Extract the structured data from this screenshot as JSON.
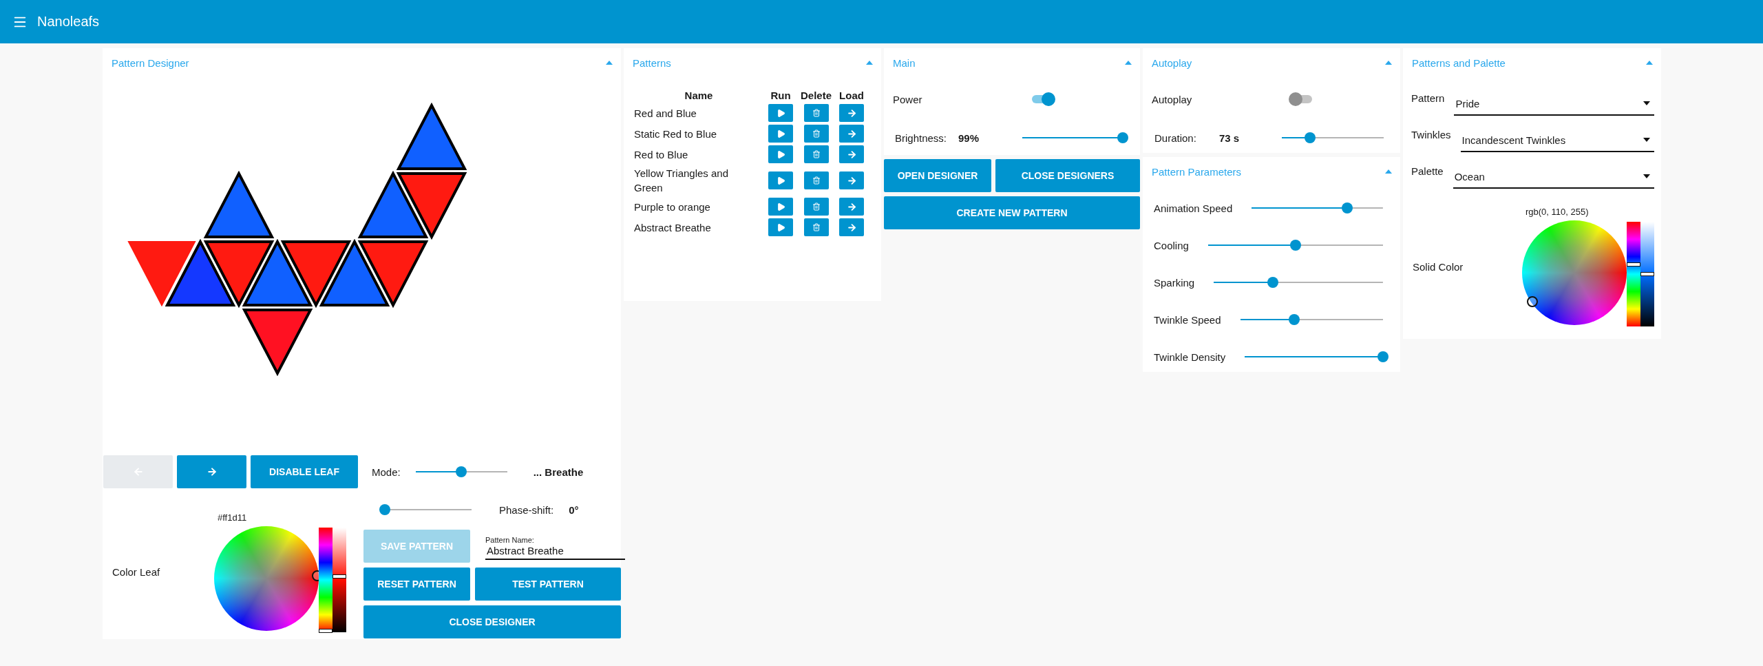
{
  "app_bar": {
    "title": "Nanoleafs"
  },
  "pattern_designer": {
    "title": "Pattern Designer",
    "leaves": [
      {
        "color": "#ff1a11",
        "selected": true
      },
      {
        "color": "#1438ff",
        "selected": false
      },
      {
        "color": "#ff1a11",
        "selected": false
      },
      {
        "color": "#1060ff",
        "selected": false
      },
      {
        "color": "#1060ff",
        "selected": false
      },
      {
        "color": "#ff1122",
        "selected": false
      },
      {
        "color": "#ff1a11",
        "selected": false
      },
      {
        "color": "#1060ff",
        "selected": false
      },
      {
        "color": "#ff1a11",
        "selected": false
      },
      {
        "color": "#1060ff",
        "selected": false
      },
      {
        "color": "#ff1a11",
        "selected": false
      },
      {
        "color": "#1060ff",
        "selected": false
      }
    ],
    "prev_button": {
      "disabled": true
    },
    "next_button": {
      "disabled": false
    },
    "disable_leaf_button": "DISABLE LEAF",
    "mode": {
      "label": "Mode:",
      "level": 0.5,
      "value": "... Breathe"
    },
    "phase": {
      "level": 0.05,
      "label": "Phase-shift:",
      "value": "0°"
    },
    "color_leaf": {
      "label": "Color Leaf",
      "value": "#ff1d11",
      "hue_slider": {
        "level": 0.01
      },
      "lightness_slider": {
        "level": 0.53
      }
    },
    "save_button": {
      "label": "SAVE PATTERN",
      "disabled": true
    },
    "pattern_name": {
      "label": "Pattern Name:",
      "value": "Abstract Breathe"
    },
    "reset_button": "RESET PATTERN",
    "test_button": "TEST PATTERN",
    "close_button": "CLOSE DESIGNER"
  },
  "patterns": {
    "title": "Patterns",
    "columns": [
      "Name",
      "Run",
      "Delete",
      "Load"
    ],
    "rows": [
      {
        "name": "Red and Blue"
      },
      {
        "name": "Static Red to Blue"
      },
      {
        "name": "Red to Blue"
      },
      {
        "name": "Yellow Triangles and Green"
      },
      {
        "name": "Purple to orange"
      },
      {
        "name": "Abstract Breathe"
      }
    ]
  },
  "main": {
    "title": "Main",
    "power": {
      "label": "Power",
      "on": true
    },
    "brightness": {
      "label": "Brightness:",
      "value": "99%",
      "level": 0.99
    },
    "open_designer_button": "OPEN DESIGNER",
    "close_designers_button": "CLOSE DESIGNERS",
    "create_pattern_button": "CREATE NEW PATTERN"
  },
  "autoplay": {
    "title": "Autoplay",
    "toggle": {
      "label": "Autoplay",
      "on": false
    },
    "duration": {
      "label": "Duration:",
      "value": "73 s",
      "level": 0.28
    }
  },
  "pattern_parameters": {
    "title": "Pattern Parameters",
    "sliders": [
      {
        "label": "Animation Speed",
        "level": 0.73
      },
      {
        "label": "Cooling",
        "level": 0.5
      },
      {
        "label": "Sparking",
        "level": 0.35
      },
      {
        "label": "Twinkle Speed",
        "level": 0.38
      },
      {
        "label": "Twinkle Density",
        "level": 1.0
      }
    ]
  },
  "patterns_and_palette": {
    "title": "Patterns and Palette",
    "selects": [
      {
        "label": "Pattern",
        "value": "Pride"
      },
      {
        "label": "Twinkles",
        "value": "Incandescent Twinkles"
      },
      {
        "label": "Palette",
        "value": "Ocean"
      }
    ],
    "solid_color": {
      "label": "Solid Color",
      "value": "rgb(0, 110, 255)",
      "hue_slider": {
        "level": 0.59
      },
      "lightness_slider": {
        "level": 0.5
      }
    }
  }
}
